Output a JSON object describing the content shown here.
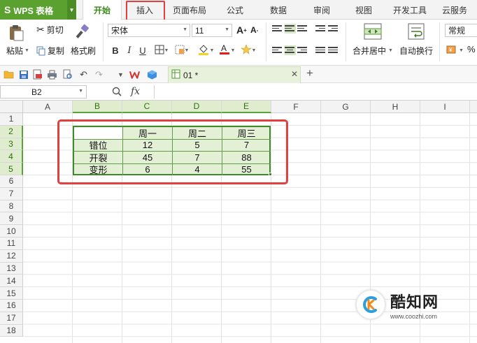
{
  "app": {
    "name": "WPS 表格"
  },
  "menu": {
    "tabs": [
      "开始",
      "插入",
      "页面布局",
      "公式",
      "数据",
      "审阅",
      "视图",
      "开发工具",
      "云服务"
    ],
    "active_tab": "开始",
    "highlighted_tab": "插入"
  },
  "ribbon": {
    "paste": "粘贴",
    "cut": "剪切",
    "copy": "复制",
    "format_painter": "格式刷",
    "font_name": "宋体",
    "font_size": "11",
    "bold": "B",
    "italic": "I",
    "underline": "U",
    "merge_center": "合并居中",
    "wrap_text": "自动换行",
    "number_format": "常规",
    "percent": "%"
  },
  "document": {
    "tab_title": "01 *"
  },
  "formula_bar": {
    "cell_ref": "B2",
    "fx_label": "fx",
    "content": ""
  },
  "grid": {
    "columns": [
      "A",
      "B",
      "C",
      "D",
      "E",
      "F",
      "G",
      "H",
      "I"
    ],
    "rows": [
      "1",
      "2",
      "3",
      "4",
      "5",
      "6",
      "7",
      "8",
      "9",
      "10",
      "11",
      "12",
      "13",
      "14",
      "15",
      "16",
      "17",
      "18"
    ],
    "selected_columns": [
      "B",
      "C",
      "D",
      "E"
    ],
    "selected_rows": [
      "2",
      "3",
      "4",
      "5"
    ]
  },
  "table": {
    "headers": [
      "",
      "周一",
      "周二",
      "周三"
    ],
    "rows": [
      {
        "label": "错位",
        "values": [
          "12",
          "5",
          "7"
        ]
      },
      {
        "label": "开裂",
        "values": [
          "45",
          "7",
          "88"
        ]
      },
      {
        "label": "变形",
        "values": [
          "6",
          "4",
          "55"
        ]
      }
    ]
  },
  "watermark": {
    "title": "酷知网",
    "url": "www.coozhi.com"
  },
  "colors": {
    "accent": "#5aa130",
    "highlight": "#e04040",
    "table_fill": "#e4f0d6",
    "table_border": "#3f8a2a"
  }
}
